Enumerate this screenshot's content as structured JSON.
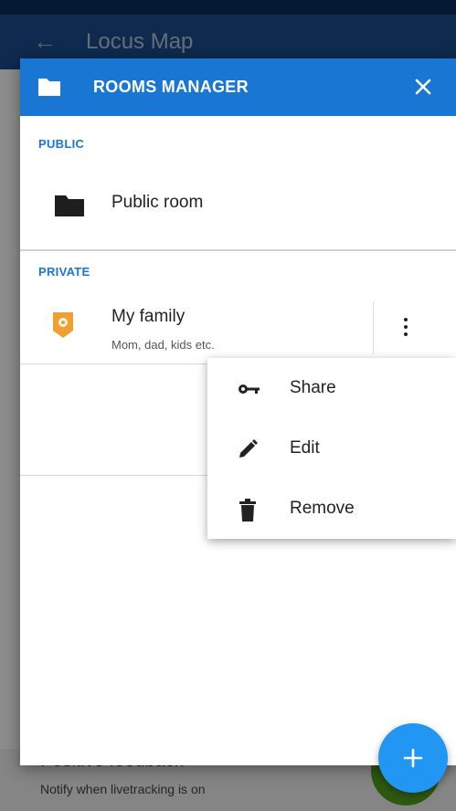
{
  "background": {
    "app_title": "Locus Map",
    "lower_title": "Positive feedback",
    "lower_subtitle": "Notify when livetracking is on"
  },
  "dialog": {
    "title": "ROOMS MANAGER",
    "sections": {
      "public": {
        "label": "PUBLIC",
        "rooms": [
          {
            "name": "Public room"
          }
        ]
      },
      "private": {
        "label": "PRIVATE",
        "rooms": [
          {
            "name": "My family",
            "description": "Mom, dad, kids etc."
          }
        ]
      }
    }
  },
  "menu": {
    "items": [
      {
        "label": "Share",
        "icon": "key-icon"
      },
      {
        "label": "Edit",
        "icon": "pencil-icon"
      },
      {
        "label": "Remove",
        "icon": "trash-icon"
      }
    ]
  },
  "colors": {
    "header": "#1976d2",
    "section_label": "#1976d2",
    "fab": "#2196f3",
    "room_icon": "#f0a030"
  }
}
